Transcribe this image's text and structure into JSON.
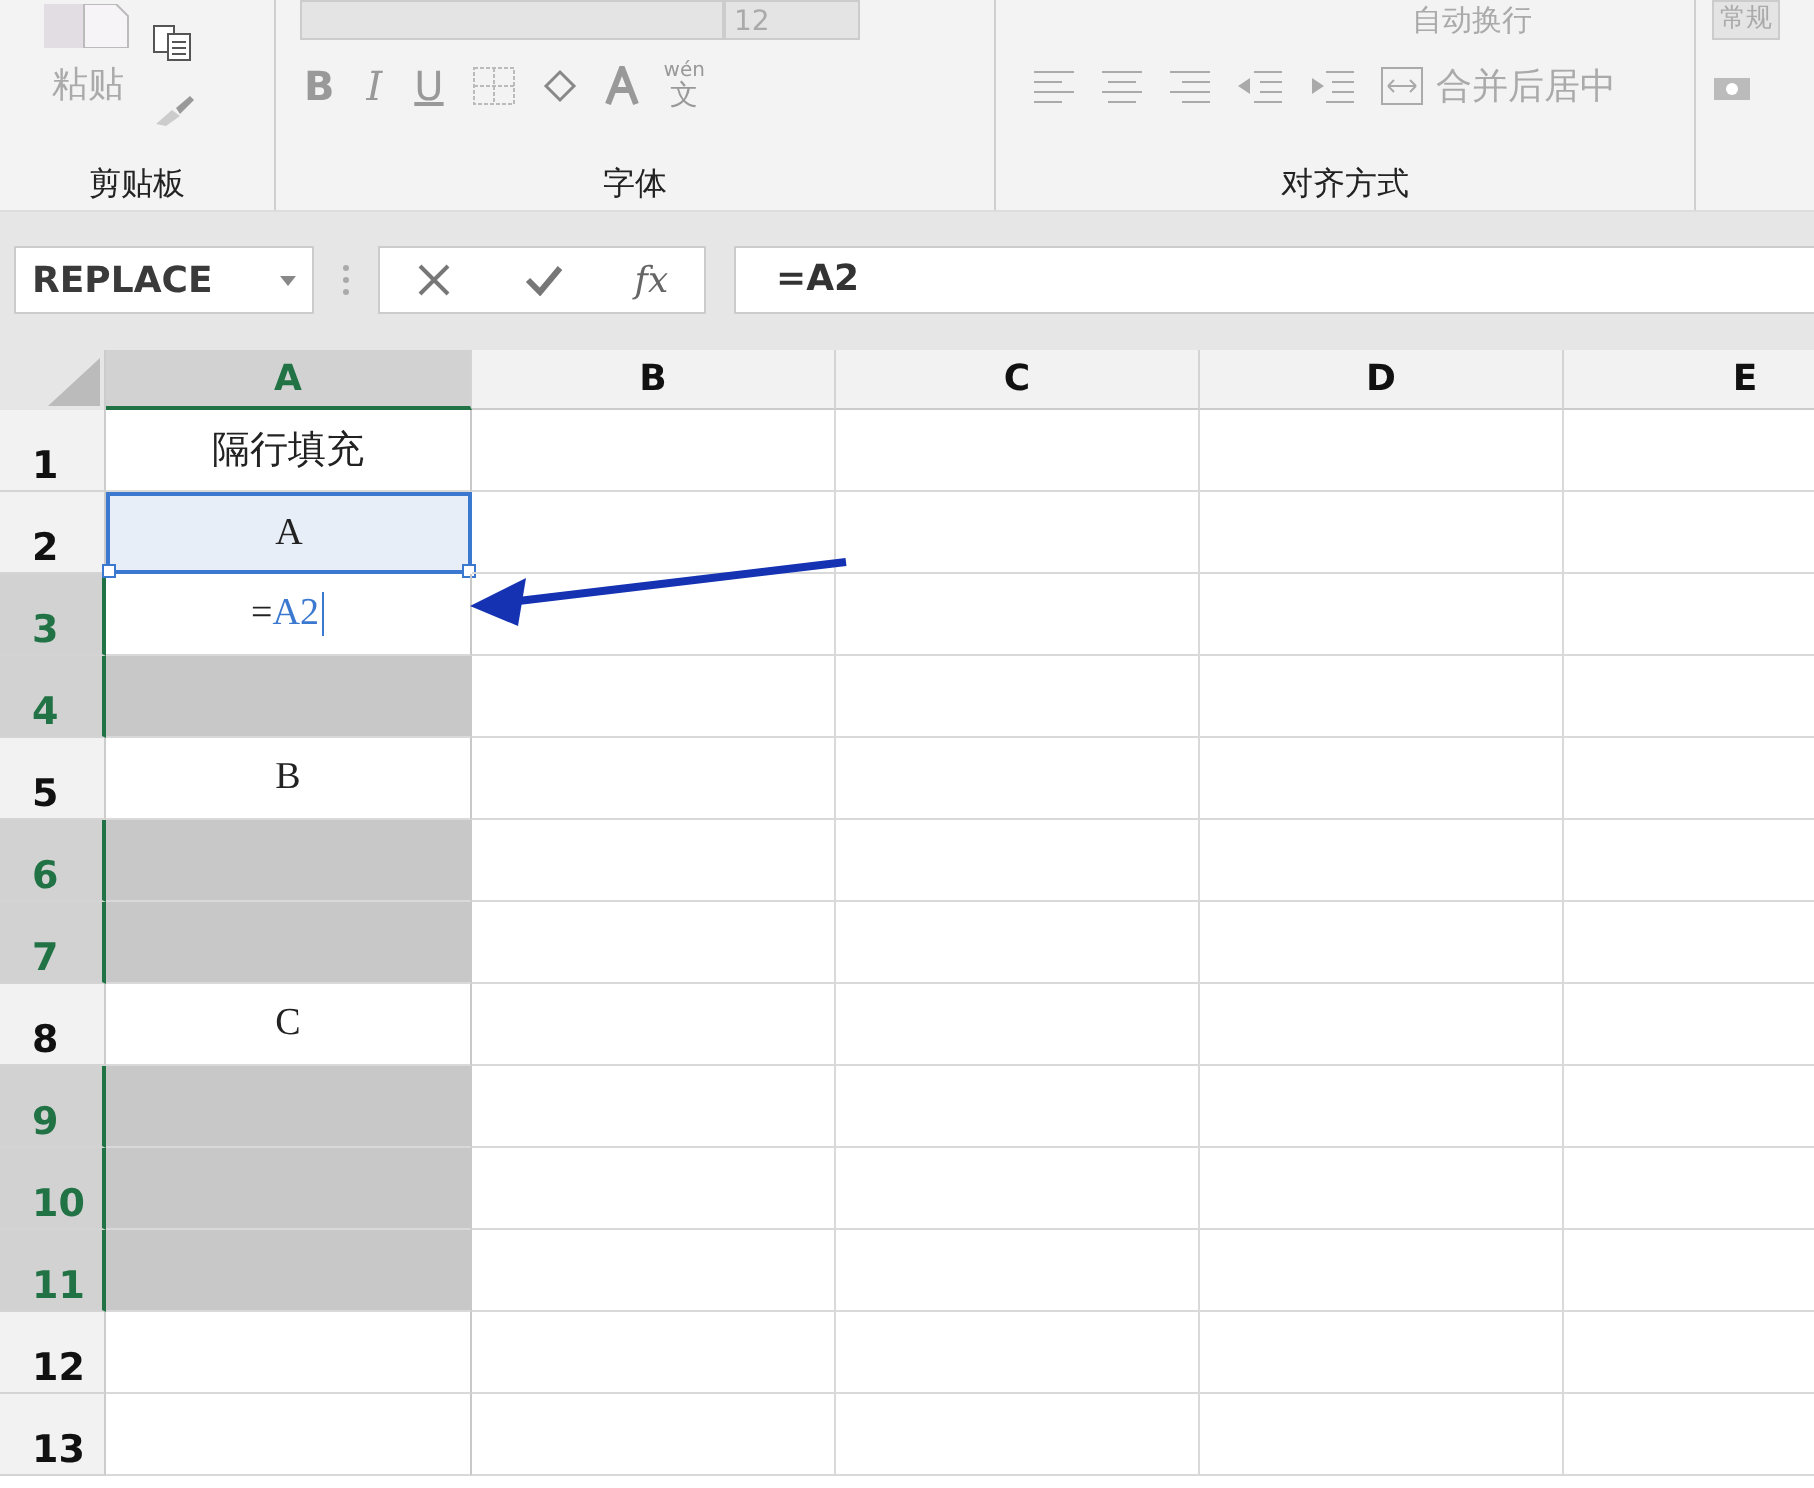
{
  "ribbon": {
    "clipboard": {
      "paste_label": "粘贴",
      "group_label": "剪贴板"
    },
    "font": {
      "size": "12",
      "bold": "B",
      "italic": "I",
      "underline": "U",
      "phonetic_top": "wén",
      "phonetic_bottom": "文",
      "group_label": "字体"
    },
    "alignment": {
      "wrap_label": "自动换行",
      "merge_label": "合并后居中",
      "group_label": "对齐方式"
    },
    "number": {
      "format": "常规"
    }
  },
  "formula_bar": {
    "name_box": "REPLACE",
    "fx": "fx",
    "formula": "=A2"
  },
  "columns": [
    {
      "label": "A",
      "selected": true
    },
    {
      "label": "B",
      "selected": false
    },
    {
      "label": "C",
      "selected": false
    },
    {
      "label": "D",
      "selected": false
    },
    {
      "label": "E",
      "selected": false
    }
  ],
  "rows": [
    {
      "label": "1",
      "selected": false,
      "a": {
        "text": "隔行填充",
        "kind": "text",
        "shaded": false,
        "active": false
      }
    },
    {
      "label": "2",
      "selected": false,
      "a": {
        "text": "A",
        "kind": "text",
        "shaded": false,
        "active": true
      }
    },
    {
      "label": "3",
      "selected": true,
      "a": {
        "text": "=",
        "ref": "A2",
        "kind": "formula",
        "shaded": false,
        "active": false
      }
    },
    {
      "label": "4",
      "selected": true,
      "a": {
        "kind": "text",
        "shaded": true,
        "active": false
      }
    },
    {
      "label": "5",
      "selected": false,
      "a": {
        "text": "B",
        "kind": "text",
        "shaded": false,
        "active": false
      }
    },
    {
      "label": "6",
      "selected": true,
      "a": {
        "kind": "text",
        "shaded": true,
        "active": false
      }
    },
    {
      "label": "7",
      "selected": true,
      "a": {
        "kind": "text",
        "shaded": true,
        "active": false
      }
    },
    {
      "label": "8",
      "selected": false,
      "a": {
        "text": "C",
        "kind": "text",
        "shaded": false,
        "active": false
      }
    },
    {
      "label": "9",
      "selected": true,
      "a": {
        "kind": "text",
        "shaded": true,
        "active": false
      }
    },
    {
      "label": "10",
      "selected": true,
      "a": {
        "kind": "text",
        "shaded": true,
        "active": false
      }
    },
    {
      "label": "11",
      "selected": true,
      "a": {
        "kind": "text",
        "shaded": true,
        "active": false
      }
    },
    {
      "label": "12",
      "selected": false,
      "a": {
        "kind": "text",
        "shaded": false,
        "active": false
      }
    },
    {
      "label": "13",
      "selected": false,
      "a": {
        "kind": "text",
        "shaded": false,
        "active": false
      }
    }
  ]
}
